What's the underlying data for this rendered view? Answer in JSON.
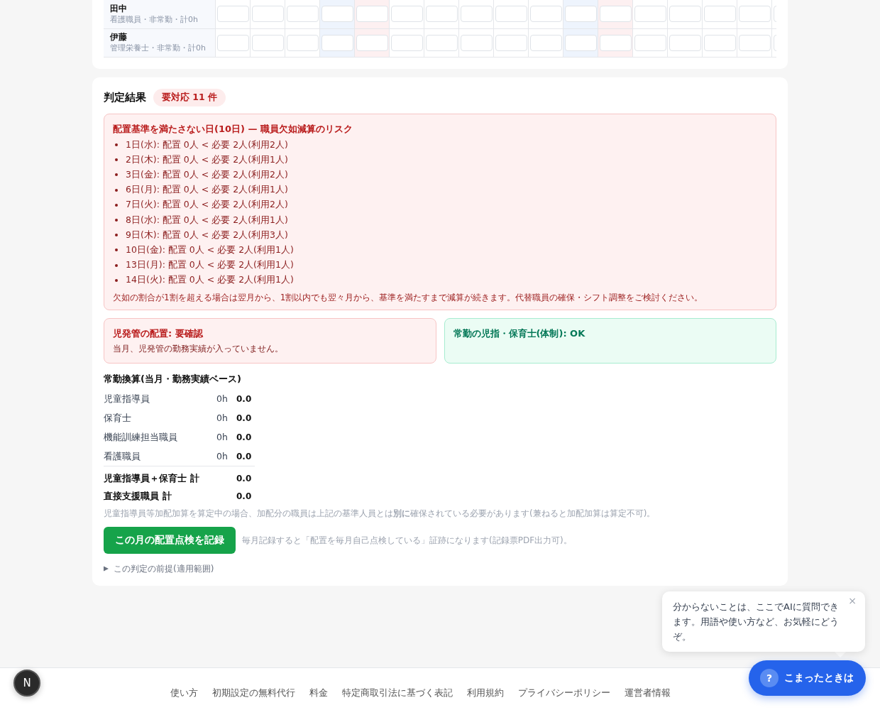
{
  "staff_table": {
    "columns": [
      {
        "color": "#ffffff"
      },
      {
        "color": "#ffffff"
      },
      {
        "color": "#ffffff"
      },
      {
        "color": "#eef4fd"
      },
      {
        "color": "#fdf0f1"
      },
      {
        "color": "#ffffff"
      },
      {
        "color": "#ffffff"
      },
      {
        "color": "#ffffff"
      },
      {
        "color": "#ffffff"
      },
      {
        "color": "#ffffff"
      },
      {
        "color": "#eef4fd"
      },
      {
        "color": "#fdf0f1"
      },
      {
        "color": "#ffffff"
      },
      {
        "color": "#ffffff"
      },
      {
        "color": "#ffffff"
      },
      {
        "color": "#ffffff"
      },
      {
        "color": "#ffffff"
      }
    ],
    "rows": [
      {
        "name": "田中",
        "detail": "看護職員・非常勤・計0h"
      },
      {
        "name": "伊藤",
        "detail": "管理栄養士・非常勤・計0h"
      }
    ]
  },
  "judgement": {
    "title": "判定結果",
    "badge": "要対応 11 件",
    "shortage": {
      "title": "配置基準を満たさない日(10日) — 職員欠如減算のリスク",
      "items": [
        "1日(水): 配置 0人 < 必要 2人(利用2人)",
        "2日(木): 配置 0人 < 必要 2人(利用1人)",
        "3日(金): 配置 0人 < 必要 2人(利用2人)",
        "6日(月): 配置 0人 < 必要 2人(利用1人)",
        "7日(火): 配置 0人 < 必要 2人(利用2人)",
        "8日(水): 配置 0人 < 必要 2人(利用1人)",
        "9日(木): 配置 0人 < 必要 2人(利用3人)",
        "10日(金): 配置 0人 < 必要 2人(利用1人)",
        "13日(月): 配置 0人 < 必要 2人(利用1人)",
        "14日(火): 配置 0人 < 必要 2人(利用1人)"
      ],
      "note": "欠如の割合が1割を超える場合は翌月から、1割以内でも翌々月から、基準を満たすまで減算が続きます。代替職員の確保・シフト調整をご検討ください。"
    },
    "checks": [
      {
        "kind": "warning",
        "title": "児発管の配置: 要確認",
        "text": "当月、児発管の勤務実績が入っていません。"
      },
      {
        "kind": "ok",
        "title": "常勤の児指・保育士(体制): OK"
      }
    ],
    "fte": {
      "title": "常勤換算(当月・勤務実績ベース)",
      "rows": [
        {
          "label": "児童指導員",
          "hours": "0h",
          "value": "0.0"
        },
        {
          "label": "保育士",
          "hours": "0h",
          "value": "0.0"
        },
        {
          "label": "機能訓練担当職員",
          "hours": "0h",
          "value": "0.0"
        },
        {
          "label": "看護職員",
          "hours": "0h",
          "value": "0.0"
        }
      ],
      "totals": [
        {
          "label": "児童指導員＋保育士 計",
          "value": "0.0"
        },
        {
          "label": "直接支援職員 計",
          "value": "0.0"
        }
      ],
      "note": "児童指導員等加配加算を算定中の場合、加配分の職員は上記の基準人員とは**別に**確保されている必要があります(兼ねると加配加算は算定不可)。"
    },
    "record": {
      "button": "この月の配置点検を記録",
      "hint": "毎月記録すると「配置を毎月自己点検している」証跡になります(記録票PDF出力可)。"
    },
    "disclosure": {
      "label": "この判定の前提(適用範囲)",
      "expanded": false
    }
  },
  "chat_tip": {
    "text": "分からないことは、ここでAIに質問できます。用語や使い方など、お気軽にどうぞ。",
    "close": "×"
  },
  "help_button": {
    "icon": "?",
    "label": "こまったときは"
  },
  "dev_badge": {
    "label": "N"
  },
  "footer": {
    "links": [
      "使い方",
      "初期設定の無料代行",
      "料金",
      "特定商取引法に基づく表記",
      "利用規約",
      "プライバシーポリシー",
      "運営者情報"
    ]
  }
}
